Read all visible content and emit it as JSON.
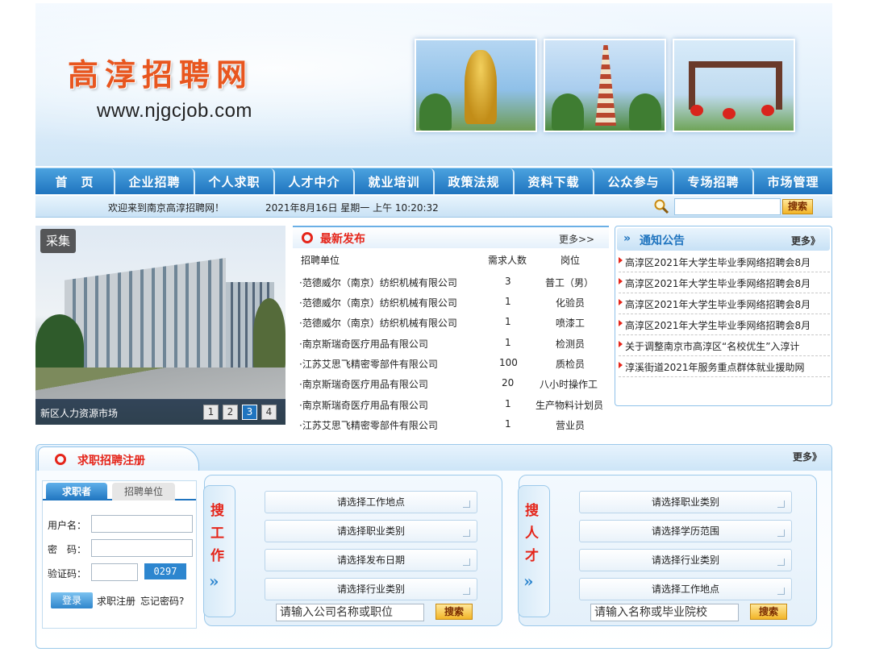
{
  "banner": {
    "site_title": "高淳招聘网",
    "site_url": "www.njgcjob.com"
  },
  "nav": {
    "items": [
      "首　页",
      "企业招聘",
      "个人求职",
      "人才中介",
      "就业培训",
      "政策法规",
      "资料下载",
      "公众参与",
      "专场招聘",
      "市场管理"
    ]
  },
  "infobar": {
    "welcome": "欢迎来到南京高淳招聘网！",
    "datetime": "2021年8月16日 星期一 上午 10:20:32",
    "search_button": "搜索"
  },
  "slideshow": {
    "tag": "采集",
    "caption": "新区人力资源市场",
    "pages": [
      "1",
      "2",
      "3",
      "4"
    ],
    "active_page": "3"
  },
  "latest": {
    "title": "最新发布",
    "more": "更多>>",
    "headers": {
      "company": "招聘单位",
      "count": "需求人数",
      "position": "岗位"
    },
    "rows": [
      {
        "company": "·范德威尔（南京）纺织机械有限公司",
        "count": "3",
        "position": "普工（男）"
      },
      {
        "company": "·范德威尔（南京）纺织机械有限公司",
        "count": "1",
        "position": "化验员"
      },
      {
        "company": "·范德威尔（南京）纺织机械有限公司",
        "count": "1",
        "position": "喷漆工"
      },
      {
        "company": "·南京斯瑞奇医疗用品有限公司",
        "count": "1",
        "position": "检测员"
      },
      {
        "company": "·江苏艾思飞精密零部件有限公司",
        "count": "100",
        "position": "质检员"
      },
      {
        "company": "·南京斯瑞奇医疗用品有限公司",
        "count": "20",
        "position": "八小时操作工"
      },
      {
        "company": "·南京斯瑞奇医疗用品有限公司",
        "count": "1",
        "position": "生产物料计划员"
      },
      {
        "company": "·江苏艾思飞精密零部件有限公司",
        "count": "1",
        "position": "营业员"
      }
    ]
  },
  "notice": {
    "title": "通知公告",
    "more": "更多》",
    "items": [
      "高淳区2021年大学生毕业季网络招聘会8月",
      "高淳区2021年大学生毕业季网络招聘会8月",
      "高淳区2021年大学生毕业季网络招聘会8月",
      "高淳区2021年大学生毕业季网络招聘会8月",
      "关于调整南京市高淳区“名校优生”入淳计",
      "淳溪街道2021年服务重点群体就业援助网"
    ]
  },
  "register": {
    "title": "求职招聘注册",
    "more": "更多》",
    "tab_jobseeker": "求职者",
    "tab_employer": "招聘单位",
    "username_label": "用户名：",
    "password_label": "密　码：",
    "captcha_label": "验证码：",
    "captcha_value": "0297",
    "login_button": "登录",
    "register_link": "求职注册",
    "forgot_link": "忘记密码?"
  },
  "job_search": {
    "side_chars": [
      "搜",
      "工",
      "作"
    ],
    "selects": [
      "请选择工作地点",
      "请选择职业类别",
      "请选择发布日期",
      "请选择行业类别"
    ],
    "input_placeholder": "请输入公司名称或职位",
    "button": "搜索"
  },
  "talent_search": {
    "side_chars": [
      "搜",
      "人",
      "才"
    ],
    "selects": [
      "请选择职业类别",
      "请选择学历范围",
      "请选择行业类别",
      "请选择工作地点"
    ],
    "input_placeholder": "请输入名称或毕业院校",
    "button": "搜索"
  },
  "colors": {
    "nav_blue": "#1f74bf",
    "accent_red": "#e5251a",
    "button_gold": "#f2b527"
  }
}
